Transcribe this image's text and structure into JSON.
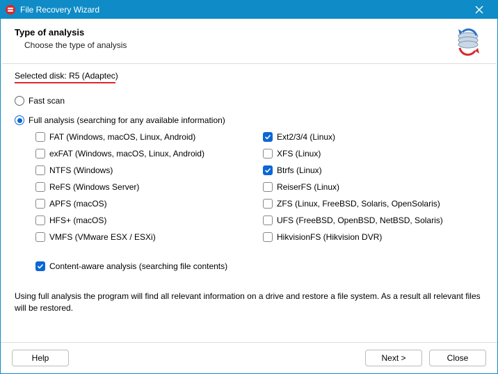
{
  "titlebar": {
    "title": "File Recovery Wizard"
  },
  "header": {
    "title": "Type of analysis",
    "subtitle": "Choose the type of analysis"
  },
  "selected_disk": {
    "label": "Selected disk:",
    "value": "R5 (Adaptec)"
  },
  "options": {
    "fast_scan": {
      "label": "Fast scan",
      "selected": false
    },
    "full_analysis": {
      "label": "Full analysis (searching for any available information)",
      "selected": true
    }
  },
  "filesystems": {
    "left": [
      {
        "key": "fat",
        "label": "FAT (Windows, macOS, Linux, Android)",
        "checked": false
      },
      {
        "key": "exfat",
        "label": "exFAT (Windows, macOS, Linux, Android)",
        "checked": false
      },
      {
        "key": "ntfs",
        "label": "NTFS (Windows)",
        "checked": false
      },
      {
        "key": "refs",
        "label": "ReFS (Windows Server)",
        "checked": false
      },
      {
        "key": "apfs",
        "label": "APFS (macOS)",
        "checked": false
      },
      {
        "key": "hfsp",
        "label": "HFS+ (macOS)",
        "checked": false
      },
      {
        "key": "vmfs",
        "label": "VMFS (VMware ESX / ESXi)",
        "checked": false
      }
    ],
    "right": [
      {
        "key": "ext",
        "label": "Ext2/3/4 (Linux)",
        "checked": true
      },
      {
        "key": "xfs",
        "label": "XFS (Linux)",
        "checked": false
      },
      {
        "key": "btrfs",
        "label": "Btrfs (Linux)",
        "checked": true
      },
      {
        "key": "reiserfs",
        "label": "ReiserFS (Linux)",
        "checked": false
      },
      {
        "key": "zfs",
        "label": "ZFS (Linux, FreeBSD, Solaris, OpenSolaris)",
        "checked": false
      },
      {
        "key": "ufs",
        "label": "UFS (FreeBSD, OpenBSD, NetBSD, Solaris)",
        "checked": false
      },
      {
        "key": "hikfs",
        "label": "HikvisionFS (Hikvision DVR)",
        "checked": false
      }
    ]
  },
  "content_aware": {
    "label": "Content-aware analysis (searching file contents)",
    "checked": true
  },
  "description": "Using full analysis the program will find all relevant information on a drive and restore a file system. As a result all relevant files will be restored.",
  "footer": {
    "help": "Help",
    "next": "Next >",
    "close": "Close"
  },
  "colors": {
    "accent": "#0f8bc7",
    "check": "#0b66d6",
    "underline": "#d9282b"
  }
}
